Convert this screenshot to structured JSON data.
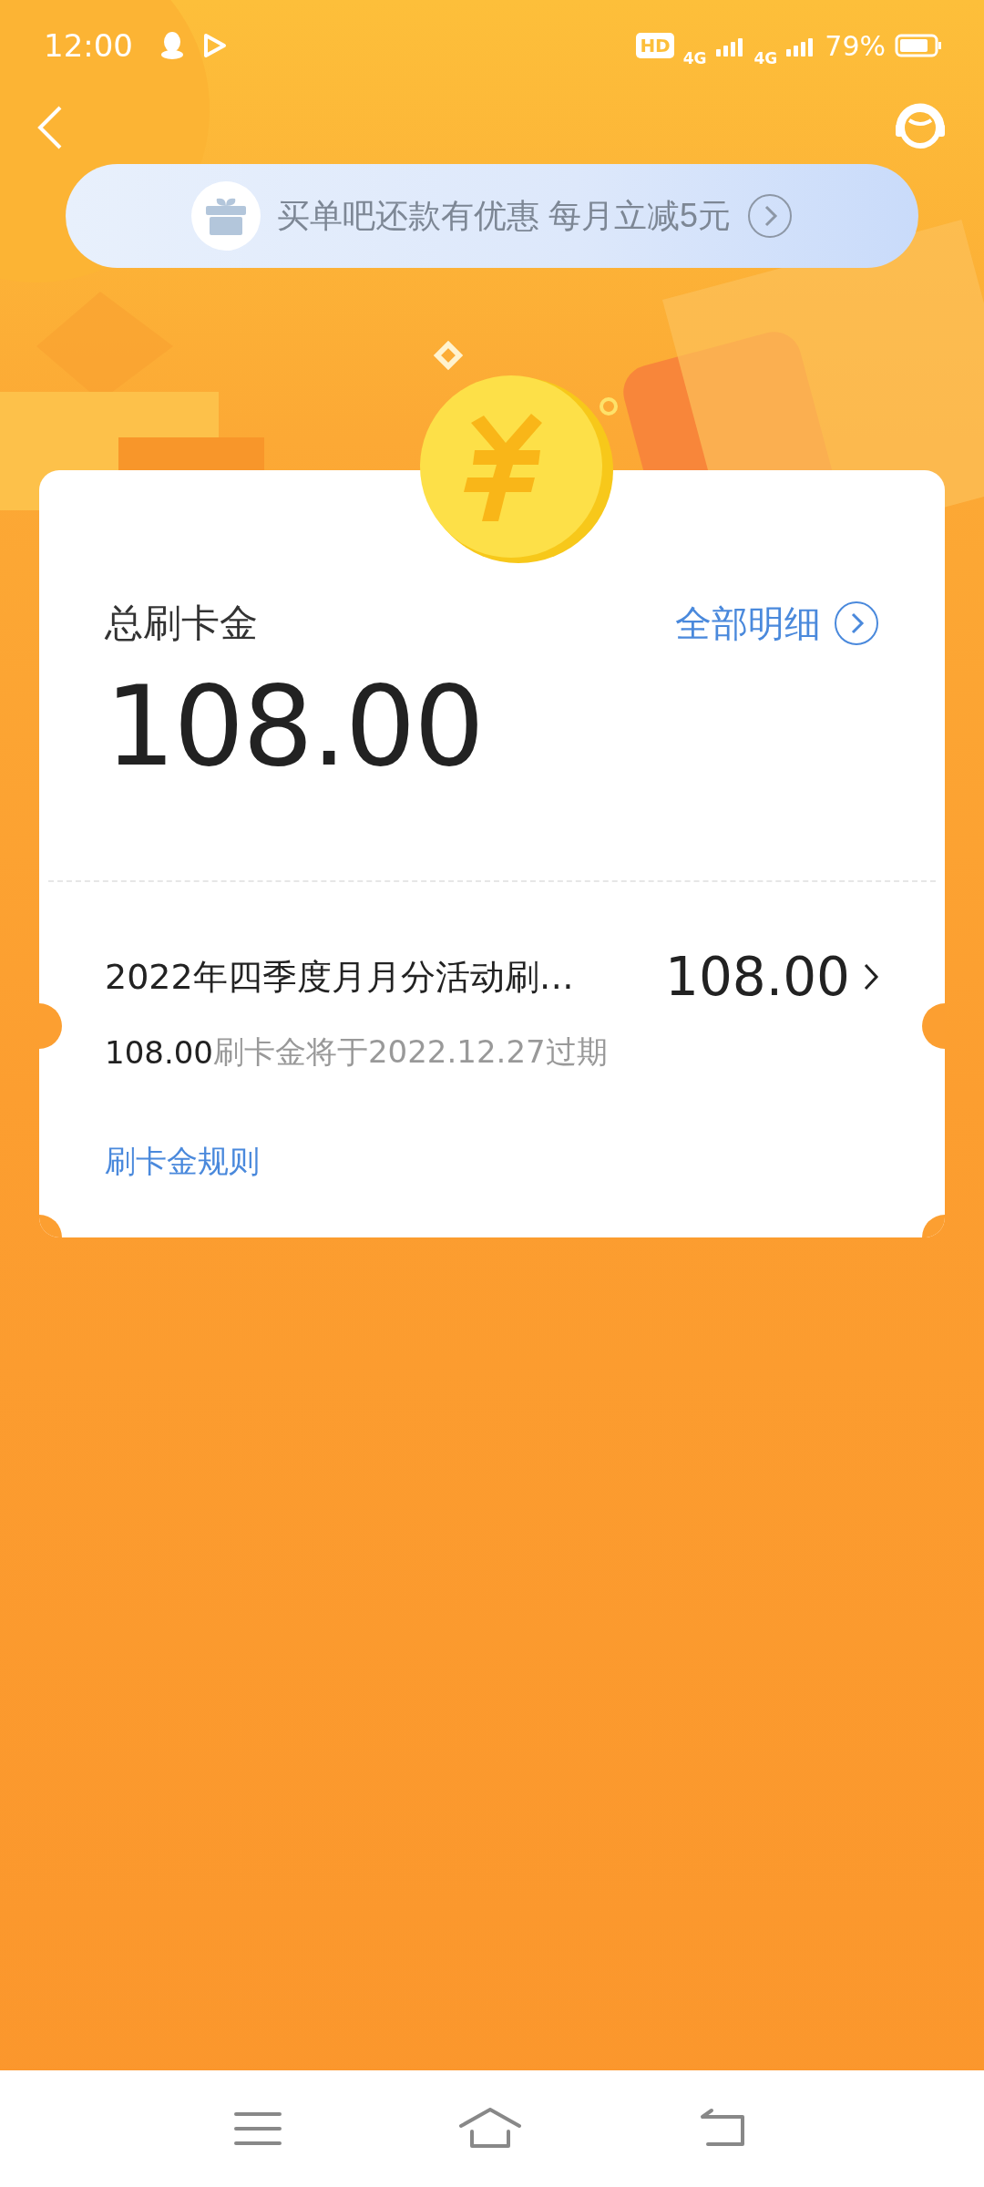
{
  "status_bar": {
    "time": "12:00",
    "hd": "HD",
    "networks": [
      "4G",
      "4G"
    ],
    "battery": "79%"
  },
  "banner": {
    "text": "买单吧还款有优惠 每月立减5元"
  },
  "balance": {
    "label": "总刷卡金",
    "details_link": "全部明细",
    "amount": "108.00"
  },
  "items": [
    {
      "title": "2022年四季度月月分活动刷…",
      "amount": "108.00",
      "expiry_amount": "108.00",
      "expiry_text": "刷卡金将于2022.12.27过期"
    }
  ],
  "rules_link": "刷卡金规则"
}
